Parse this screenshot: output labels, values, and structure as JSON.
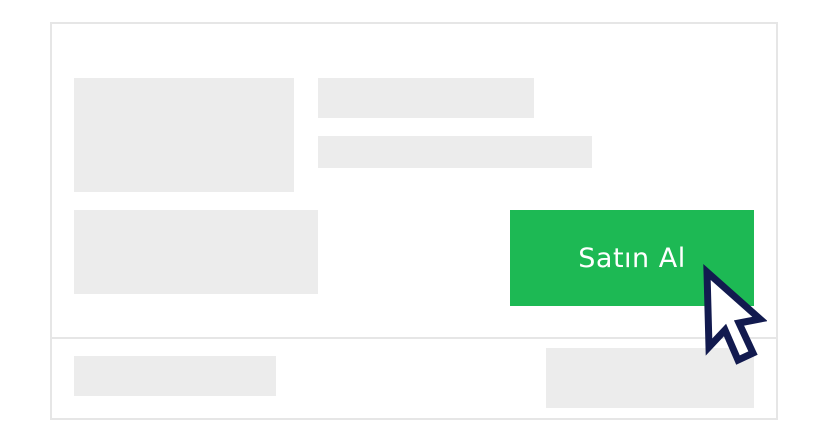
{
  "product_card": {
    "buy_button_label": "Satın Al"
  },
  "colors": {
    "buy_button": "#1db954",
    "placeholder": "#ececec",
    "border": "#e6e6e6",
    "cursor_outline": "#121a4f"
  },
  "icons": {
    "cursor": "mouse-pointer-icon"
  }
}
